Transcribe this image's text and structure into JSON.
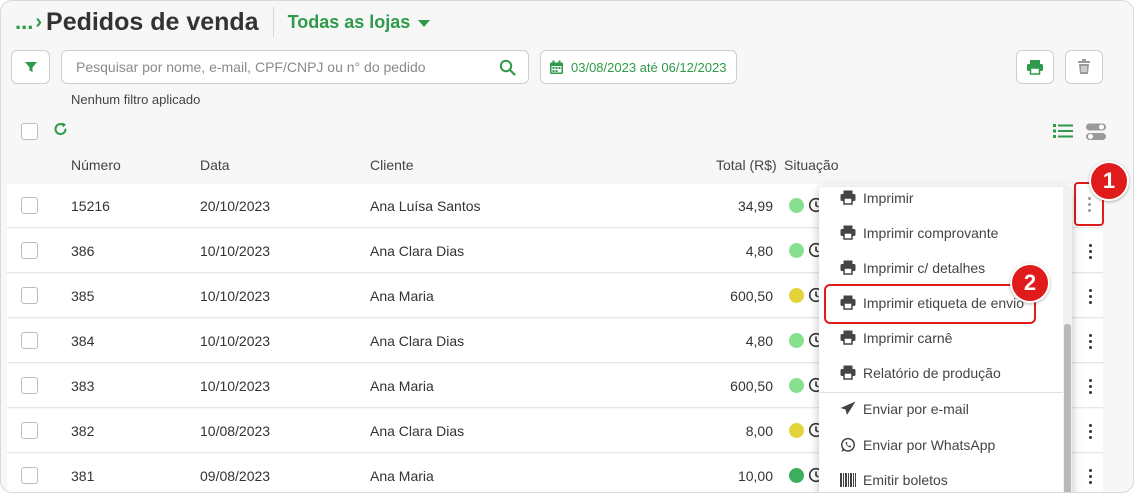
{
  "header": {
    "breadcrumb_dots": "...",
    "breadcrumb_chevron": "›",
    "title": "Pedidos de venda",
    "store_selector": "Todas as lojas"
  },
  "toolbar": {
    "search_placeholder": "Pesquisar por nome, e-mail, CPF/CNPJ ou n° do pedido",
    "search_value": "",
    "date_range": "03/08/2023 até 06/12/2023",
    "filter_note": "Nenhum filtro aplicado"
  },
  "table": {
    "columns": [
      "Número",
      "Data",
      "Cliente",
      "Total (R$)",
      "Situação"
    ],
    "rows": [
      {
        "numero": "15216",
        "data": "20/10/2023",
        "cliente": "Ana Luísa Santos",
        "total": "34,99",
        "status_color": "#86e08e"
      },
      {
        "numero": "386",
        "data": "10/10/2023",
        "cliente": "Ana Clara Dias",
        "total": "4,80",
        "status_color": "#86e08e"
      },
      {
        "numero": "385",
        "data": "10/10/2023",
        "cliente": "Ana Maria",
        "total": "600,50",
        "status_color": "#e3d43a"
      },
      {
        "numero": "384",
        "data": "10/10/2023",
        "cliente": "Ana Clara Dias",
        "total": "4,80",
        "status_color": "#86e08e"
      },
      {
        "numero": "383",
        "data": "10/10/2023",
        "cliente": "Ana Maria",
        "total": "600,50",
        "status_color": "#86e08e"
      },
      {
        "numero": "382",
        "data": "10/08/2023",
        "cliente": "Ana Clara Dias",
        "total": "8,00",
        "status_color": "#e3d43a"
      },
      {
        "numero": "381",
        "data": "09/08/2023",
        "cliente": "Ana Maria",
        "total": "10,00",
        "status_color": "#3cae5c"
      }
    ]
  },
  "menu": {
    "items": [
      {
        "label": "Imprimir",
        "icon": "printer-icon"
      },
      {
        "label": "Imprimir comprovante",
        "icon": "printer-icon"
      },
      {
        "label": "Imprimir c/ detalhes",
        "icon": "printer-icon"
      },
      {
        "label": "Imprimir etiqueta de envio",
        "icon": "printer-icon"
      },
      {
        "label": "Imprimir carnê",
        "icon": "printer-icon"
      },
      {
        "label": "Relatório de produção",
        "icon": "printer-icon"
      },
      {
        "label": "Enviar por e-mail",
        "icon": "send-icon"
      },
      {
        "label": "Enviar por WhatsApp",
        "icon": "whatsapp-icon"
      },
      {
        "label": "Emitir boletos",
        "icon": "barcode-icon"
      }
    ]
  },
  "annotations": {
    "step1": "1",
    "step2": "2"
  },
  "colors": {
    "accent": "#2e9a4a",
    "highlight": "#e01b1b"
  }
}
